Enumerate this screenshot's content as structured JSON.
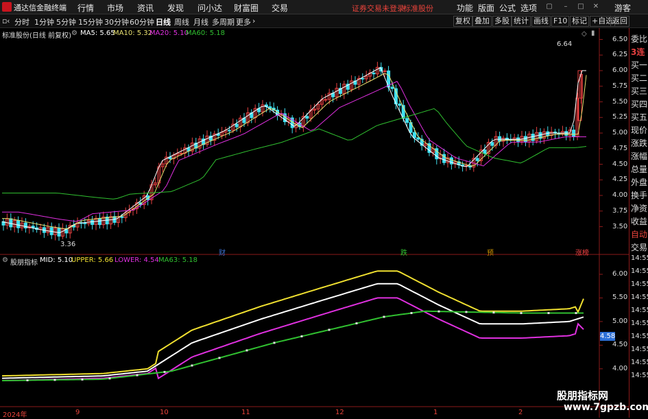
{
  "app": {
    "title": "通达信金融终端",
    "menu": [
      "行情",
      "市场",
      "资讯",
      "发现",
      "问小达",
      "财富圈",
      "交易"
    ],
    "status": "证券交易未登录",
    "stock_name_short": "标准股份",
    "right_menu": [
      "功能",
      "版面",
      "公式",
      "选项"
    ],
    "guest": "游客"
  },
  "toolbar": {
    "periods": [
      "分时",
      "1分钟",
      "5分钟",
      "15分钟",
      "30分钟",
      "60分钟",
      "日线",
      "周线",
      "月线",
      "多周期",
      "更多"
    ],
    "active": "日线",
    "right": [
      "复权",
      "叠加",
      "多股",
      "统计",
      "画线",
      "F10",
      "标记",
      "+自选",
      "返回"
    ]
  },
  "main_chart": {
    "caption": "标准股份(日线 前复权)",
    "ma": [
      {
        "name": "MA5:",
        "value": "5.65",
        "color": "#ffffff"
      },
      {
        "name": "MA10:",
        "value": "5.32",
        "color": "#e8e070"
      },
      {
        "name": "MA20:",
        "value": "5.10",
        "color": "#e030e0"
      },
      {
        "name": "MA60:",
        "value": "5.18",
        "color": "#30c030"
      }
    ],
    "high_label": "6.64",
    "low_label": "3.36",
    "y_ticks": [
      "6.50",
      "6.25",
      "6.00",
      "5.75",
      "5.50",
      "5.25",
      "5.00",
      "4.75",
      "4.50",
      "4.25",
      "4.00",
      "3.75",
      "3.50"
    ],
    "markers": [
      {
        "text": "财",
        "color": "#3a6fd0"
      },
      {
        "text": "跌",
        "color": "#30c030"
      },
      {
        "text": "预",
        "color": "#c89000"
      },
      {
        "text": "涨榜",
        "color": "#e84040"
      }
    ]
  },
  "indicator": {
    "caption": "股朋指标",
    "mid": {
      "name": "MID:",
      "value": "5.10",
      "color": "#ffffff"
    },
    "upper": {
      "name": "UPPER:",
      "value": "5.66",
      "color": "#f0e030"
    },
    "lower": {
      "name": "LOWER:",
      "value": "4.54",
      "color": "#e030e0"
    },
    "ma63": {
      "name": "MA63:",
      "value": "5.18",
      "color": "#30c030"
    },
    "y_ticks": [
      "6.00",
      "5.50",
      "5.00",
      "4.50",
      "4.00"
    ],
    "current": "4.58"
  },
  "dates": [
    "2024年",
    "9",
    "10",
    "11",
    "12",
    "1",
    "2"
  ],
  "right_panel": [
    "委比",
    "3连",
    "买一",
    "买二",
    "买三",
    "买四",
    "买五",
    "现价",
    "涨跌",
    "涨幅",
    "总量",
    "外盘",
    "换手",
    "净资",
    "收益",
    "自动",
    "交易",
    "14:55",
    "14:55",
    "14:55",
    "14:55",
    "14:55",
    "14:55",
    "14:55",
    "14:55",
    "14:55",
    "14:55"
  ],
  "watermark": {
    "line1": "股朋指标网",
    "line2": "www.7gpzb.com"
  }
}
